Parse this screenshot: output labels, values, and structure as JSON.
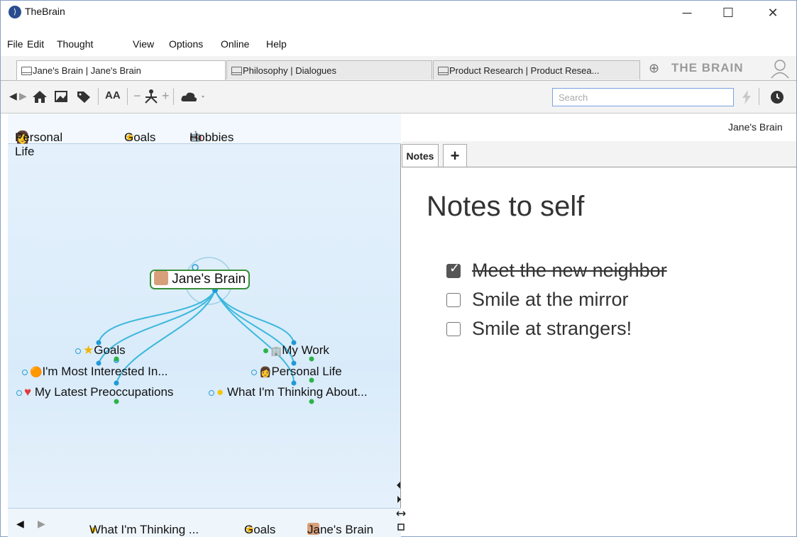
{
  "window": {
    "title": "TheBrain",
    "minimize": "─",
    "maximize": "☐",
    "close": "✕"
  },
  "menu": [
    "File",
    "Edit",
    "Thought",
    "View",
    "Options",
    "Online",
    "Help"
  ],
  "tabs": [
    {
      "label": "Jane's Brain | Jane's Brain",
      "active": true
    },
    {
      "label": "Philosophy | Dialogues",
      "active": false
    },
    {
      "label": "Product Research | Product Resea...",
      "active": false
    }
  ],
  "tab_add": "⊕",
  "brand": "THE BRAIN",
  "toolbar": {
    "back": "◀",
    "forward": "▶",
    "home": "⌂",
    "text_size": "AA",
    "minus": "−",
    "plus": "+",
    "search_placeholder": "Search",
    "clock": "●"
  },
  "pins": [
    {
      "label": "Personal Life",
      "icon": "person-icon"
    },
    {
      "label": "Goals",
      "icon": "star-icon"
    },
    {
      "label": "Hobbies",
      "icon": "robot-icon"
    }
  ],
  "plex": {
    "central": "Jane's Brain",
    "children": [
      "Goals",
      "My Work"
    ],
    "jumps": [
      "I'm Most Interested In...",
      "Personal Life",
      "My Latest Preoccupations",
      "What I'm Thinking About..."
    ]
  },
  "history": {
    "back": "◀",
    "forward": "▶",
    "items": [
      "What I'm Thinking ...",
      "Goals",
      "Jane's Brain"
    ]
  },
  "notes": {
    "breadcrumb": "Jane's Brain",
    "tab_label": "Notes",
    "add_tab": "+",
    "title": "Notes to self",
    "checklist": [
      {
        "text": "Meet the new neighbor",
        "checked": true
      },
      {
        "text": "Smile at the mirror",
        "checked": false
      },
      {
        "text": "Smile at strangers!",
        "checked": false
      }
    ]
  },
  "colors": {
    "link": "#3bb8dc",
    "active_node_border": "#3a8f3a",
    "dot_green": "#2db34a",
    "dot_blue": "#1f9ad6"
  }
}
